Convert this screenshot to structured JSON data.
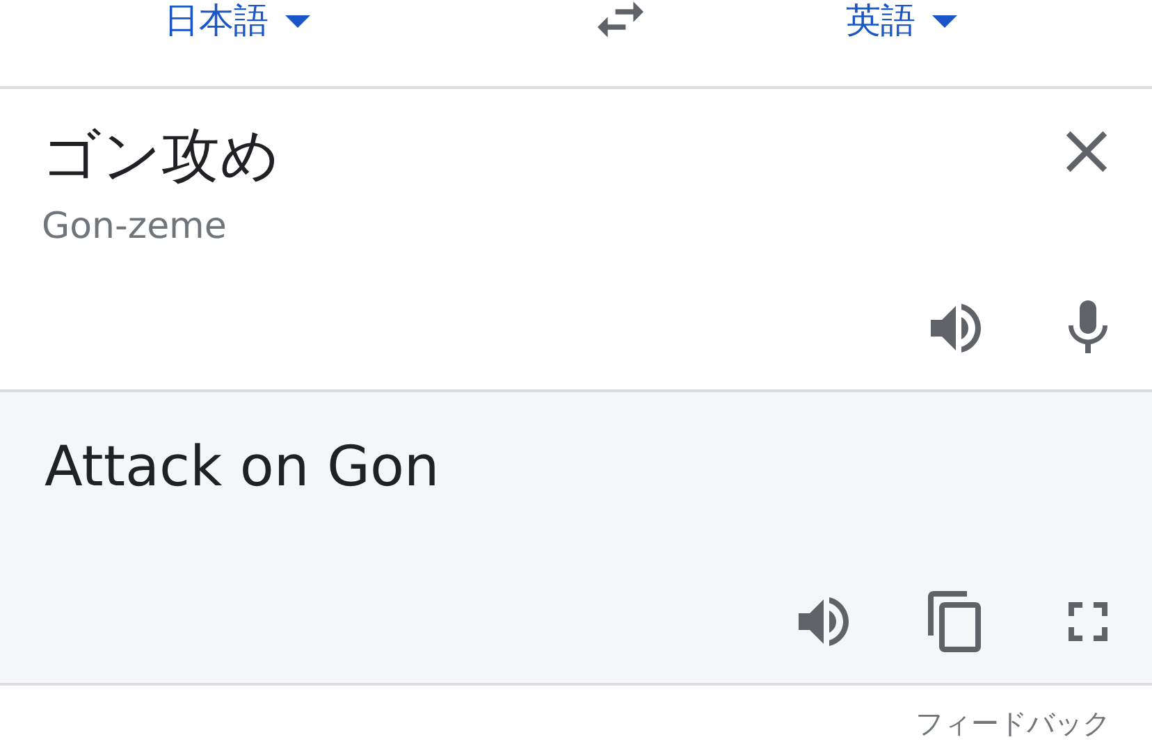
{
  "language_bar": {
    "source_language": "日本語",
    "target_language": "英語"
  },
  "input": {
    "text": "ゴン攻め",
    "romanization": "Gon-zeme"
  },
  "output": {
    "text": "Attack on Gon"
  },
  "feedback_link": "フィードバック"
}
